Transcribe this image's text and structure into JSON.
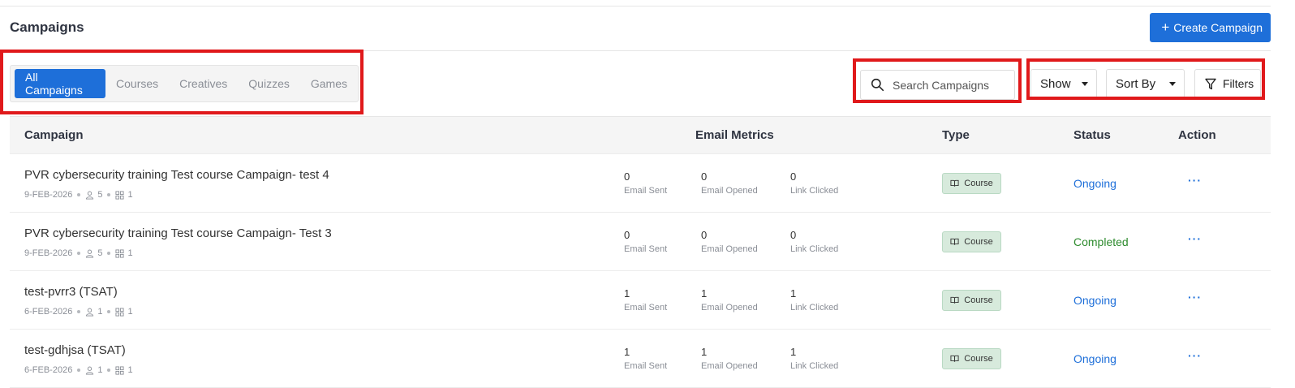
{
  "header": {
    "title": "Campaigns",
    "create_label": "Create Campaign",
    "create_icon": "plus-icon"
  },
  "tabs": [
    {
      "label": "All Campaigns",
      "active": true
    },
    {
      "label": "Courses",
      "active": false
    },
    {
      "label": "Creatives",
      "active": false
    },
    {
      "label": "Quizzes",
      "active": false
    },
    {
      "label": "Games",
      "active": false
    }
  ],
  "search": {
    "placeholder": "Search Campaigns",
    "value": ""
  },
  "toolbar": {
    "show_label": "Show",
    "sort_label": "Sort By",
    "filters_label": "Filters"
  },
  "table": {
    "headers": {
      "campaign": "Campaign",
      "email_metrics": "Email Metrics",
      "type": "Type",
      "status": "Status",
      "action": "Action"
    },
    "metric_labels": {
      "sent": "Email Sent",
      "opened": "Email Opened",
      "clicked": "Link Clicked"
    },
    "rows": [
      {
        "name": "PVR cybersecurity training Test course Campaign- test 4",
        "date": "9-FEB-2026",
        "users": "5",
        "modules": "1",
        "sent": "0",
        "opened": "0",
        "clicked": "0",
        "type": "Course",
        "status": "Ongoing",
        "action": "···"
      },
      {
        "name": "PVR cybersecurity training Test course Campaign- Test 3",
        "date": "9-FEB-2026",
        "users": "5",
        "modules": "1",
        "sent": "0",
        "opened": "0",
        "clicked": "0",
        "type": "Course",
        "status": "Completed",
        "action": "···"
      },
      {
        "name": "test-pvrr3 (TSAT)",
        "date": "6-FEB-2026",
        "users": "1",
        "modules": "1",
        "sent": "1",
        "opened": "1",
        "clicked": "1",
        "type": "Course",
        "status": "Ongoing",
        "action": "···"
      },
      {
        "name": "test-gdhjsa (TSAT)",
        "date": "6-FEB-2026",
        "users": "1",
        "modules": "1",
        "sent": "1",
        "opened": "1",
        "clicked": "1",
        "type": "Course",
        "status": "Ongoing",
        "action": "···"
      }
    ]
  },
  "colors": {
    "accent": "#1e6fd9",
    "ongoing": "#1e6fd9",
    "completed": "#2e8b2e",
    "highlight": "#e0191b",
    "badge_bg": "#d7eadc"
  }
}
